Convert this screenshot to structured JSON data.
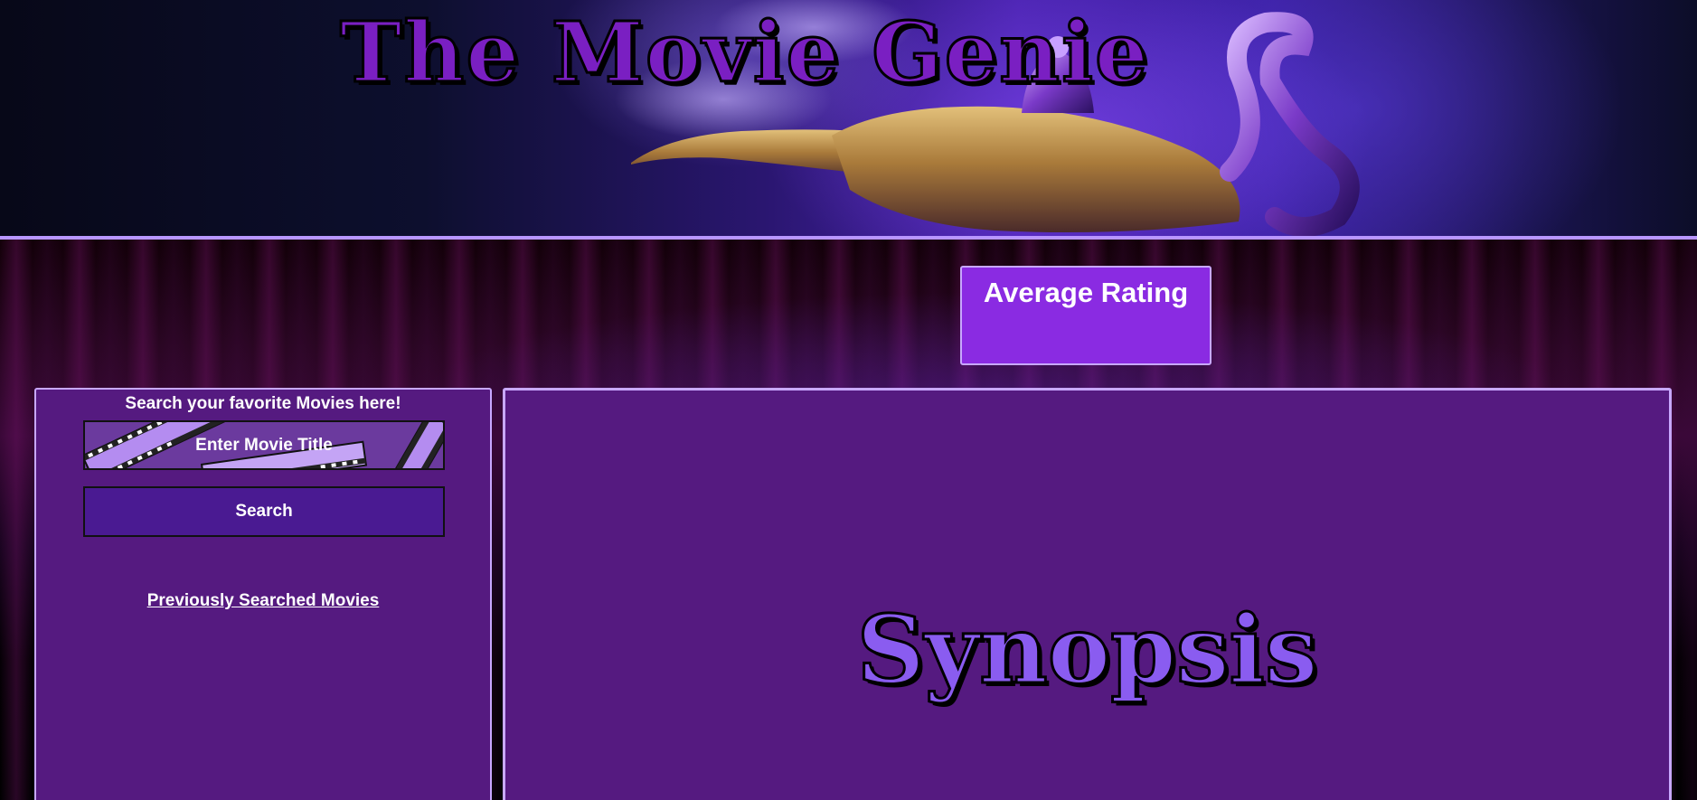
{
  "header": {
    "title": "The Movie Genie"
  },
  "rating": {
    "title": "Average Rating"
  },
  "search": {
    "heading": "Search your favorite Movies here!",
    "input_placeholder": "Enter Movie Title",
    "input_value": "",
    "button_label": "Search",
    "history_link": "Previously Searched Movies"
  },
  "synopsis": {
    "title": "Synopsis"
  },
  "colors": {
    "panel_bg": "#551a80",
    "panel_border": "#c8a8ff",
    "rating_bg": "#8a2be2",
    "button_bg": "#4a1a92",
    "title_color": "#7a1fc2",
    "synopsis_color": "#8a5cf0"
  },
  "icons": [
    "magic-lamp-icon",
    "film-strip-icon"
  ]
}
